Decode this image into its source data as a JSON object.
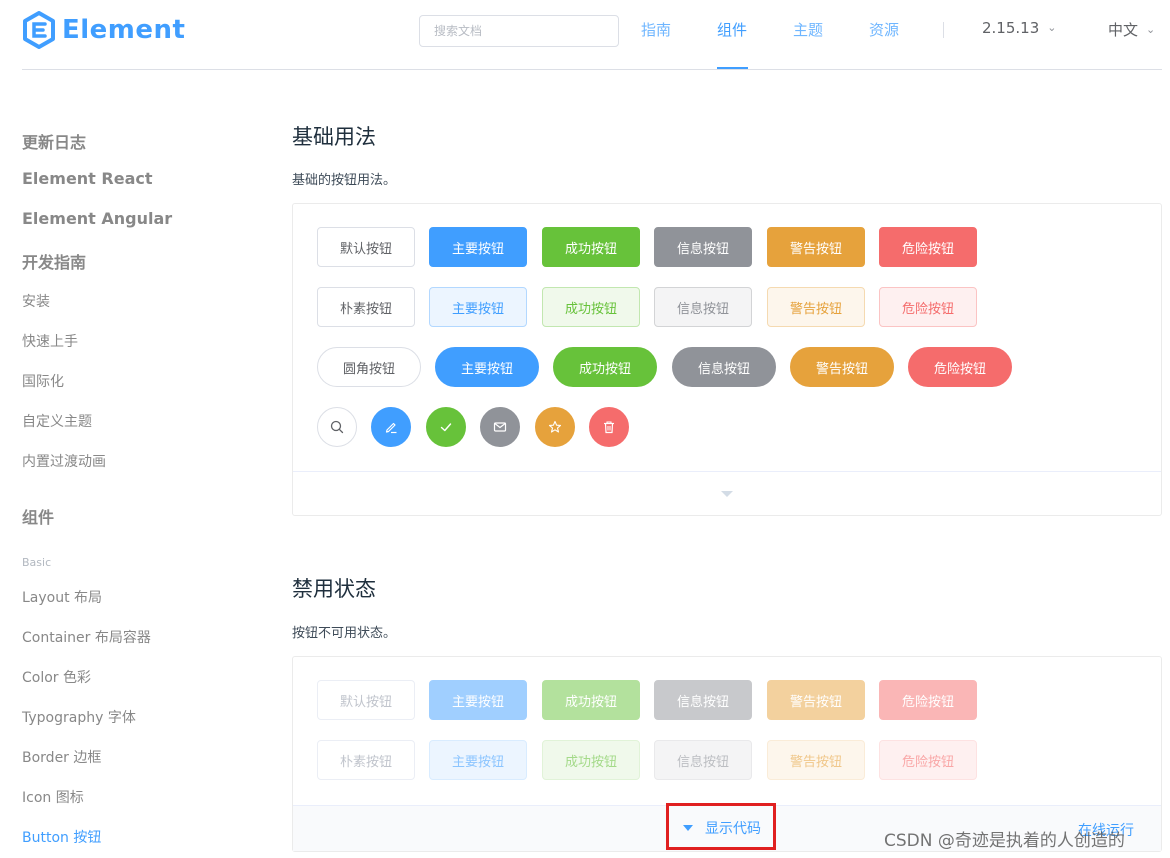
{
  "header": {
    "logo_text": "Element",
    "search_placeholder": "搜索文档",
    "nav": [
      "指南",
      "组件",
      "主题",
      "资源"
    ],
    "version": "2.15.13",
    "language": "中文"
  },
  "sidebar": {
    "items": [
      {
        "label": "更新日志",
        "kind": "h"
      },
      {
        "label": "Element React",
        "kind": "h"
      },
      {
        "label": "Element Angular",
        "kind": "h"
      },
      {
        "label": "开发指南",
        "kind": "h"
      },
      {
        "label": "安装",
        "kind": "l"
      },
      {
        "label": "快速上手",
        "kind": "l"
      },
      {
        "label": "国际化",
        "kind": "l"
      },
      {
        "label": "自定义主题",
        "kind": "l"
      },
      {
        "label": "内置过渡动画",
        "kind": "l"
      },
      {
        "label": "组件",
        "kind": "h"
      },
      {
        "label": "Basic",
        "kind": "s"
      },
      {
        "label": "Layout 布局",
        "kind": "l"
      },
      {
        "label": "Container 布局容器",
        "kind": "l"
      },
      {
        "label": "Color 色彩",
        "kind": "l"
      },
      {
        "label": "Typography 字体",
        "kind": "l"
      },
      {
        "label": "Border 边框",
        "kind": "l"
      },
      {
        "label": "Icon 图标",
        "kind": "l"
      },
      {
        "label": "Button 按钮",
        "kind": "l",
        "active": true
      }
    ]
  },
  "basic": {
    "title": "基础用法",
    "desc": "基础的按钮用法。",
    "row_default": [
      "默认按钮",
      "主要按钮",
      "成功按钮",
      "信息按钮",
      "警告按钮",
      "危险按钮"
    ],
    "row_plain": [
      "朴素按钮",
      "主要按钮",
      "成功按钮",
      "信息按钮",
      "警告按钮",
      "危险按钮"
    ],
    "row_round": [
      "圆角按钮",
      "主要按钮",
      "成功按钮",
      "信息按钮",
      "警告按钮",
      "危险按钮"
    ],
    "row_circle_icons": [
      "search-icon",
      "edit-icon",
      "check-icon",
      "message-icon",
      "star-icon",
      "delete-icon"
    ]
  },
  "disabled": {
    "title": "禁用状态",
    "desc": "按钮不可用状态。",
    "row_default": [
      "默认按钮",
      "主要按钮",
      "成功按钮",
      "信息按钮",
      "警告按钮",
      "危险按钮"
    ],
    "row_plain": [
      "朴素按钮",
      "主要按钮",
      "成功按钮",
      "信息按钮",
      "警告按钮",
      "危险按钮"
    ],
    "show_code": "显示代码",
    "online_run": "在线运行"
  },
  "watermark": "CSDN @奇迹是执着的人创造的",
  "colors": {
    "brand": "#409eff",
    "success": "#67c23a",
    "info": "#909399",
    "warning": "#e6a23c",
    "danger": "#f56c6c",
    "highlight": "#e02020"
  }
}
